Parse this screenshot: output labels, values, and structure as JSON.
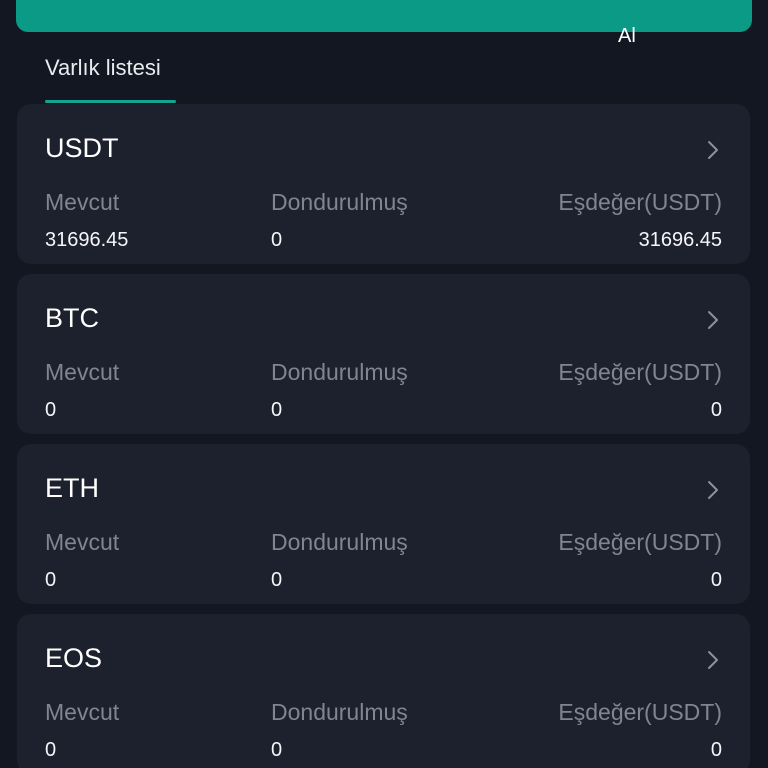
{
  "top_action": {
    "label": "Al"
  },
  "tabs": {
    "active_label": "Varlık listesi"
  },
  "assets": [
    {
      "symbol": "USDT",
      "available_label": "Mevcut",
      "available": "31696.45",
      "frozen_label": "Dondurulmuş",
      "frozen": "0",
      "equivalent_label": "Eşdeğer(USDT)",
      "equivalent": "31696.45"
    },
    {
      "symbol": "BTC",
      "available_label": "Mevcut",
      "available": "0",
      "frozen_label": "Dondurulmuş",
      "frozen": "0",
      "equivalent_label": "Eşdeğer(USDT)",
      "equivalent": "0"
    },
    {
      "symbol": "ETH",
      "available_label": "Mevcut",
      "available": "0",
      "frozen_label": "Dondurulmuş",
      "frozen": "0",
      "equivalent_label": "Eşdeğer(USDT)",
      "equivalent": "0"
    },
    {
      "symbol": "EOS",
      "available_label": "Mevcut",
      "available": "0",
      "frozen_label": "Dondurulmuş",
      "frozen": "0",
      "equivalent_label": "Eşdeğer(USDT)",
      "equivalent": "0"
    }
  ],
  "colors": {
    "background": "#131722",
    "card": "#1d212d",
    "accent": "#0b9a86",
    "muted_text": "#7f8591",
    "text": "#ffffff"
  },
  "icons": {
    "chevron": "chevron-right-icon"
  }
}
